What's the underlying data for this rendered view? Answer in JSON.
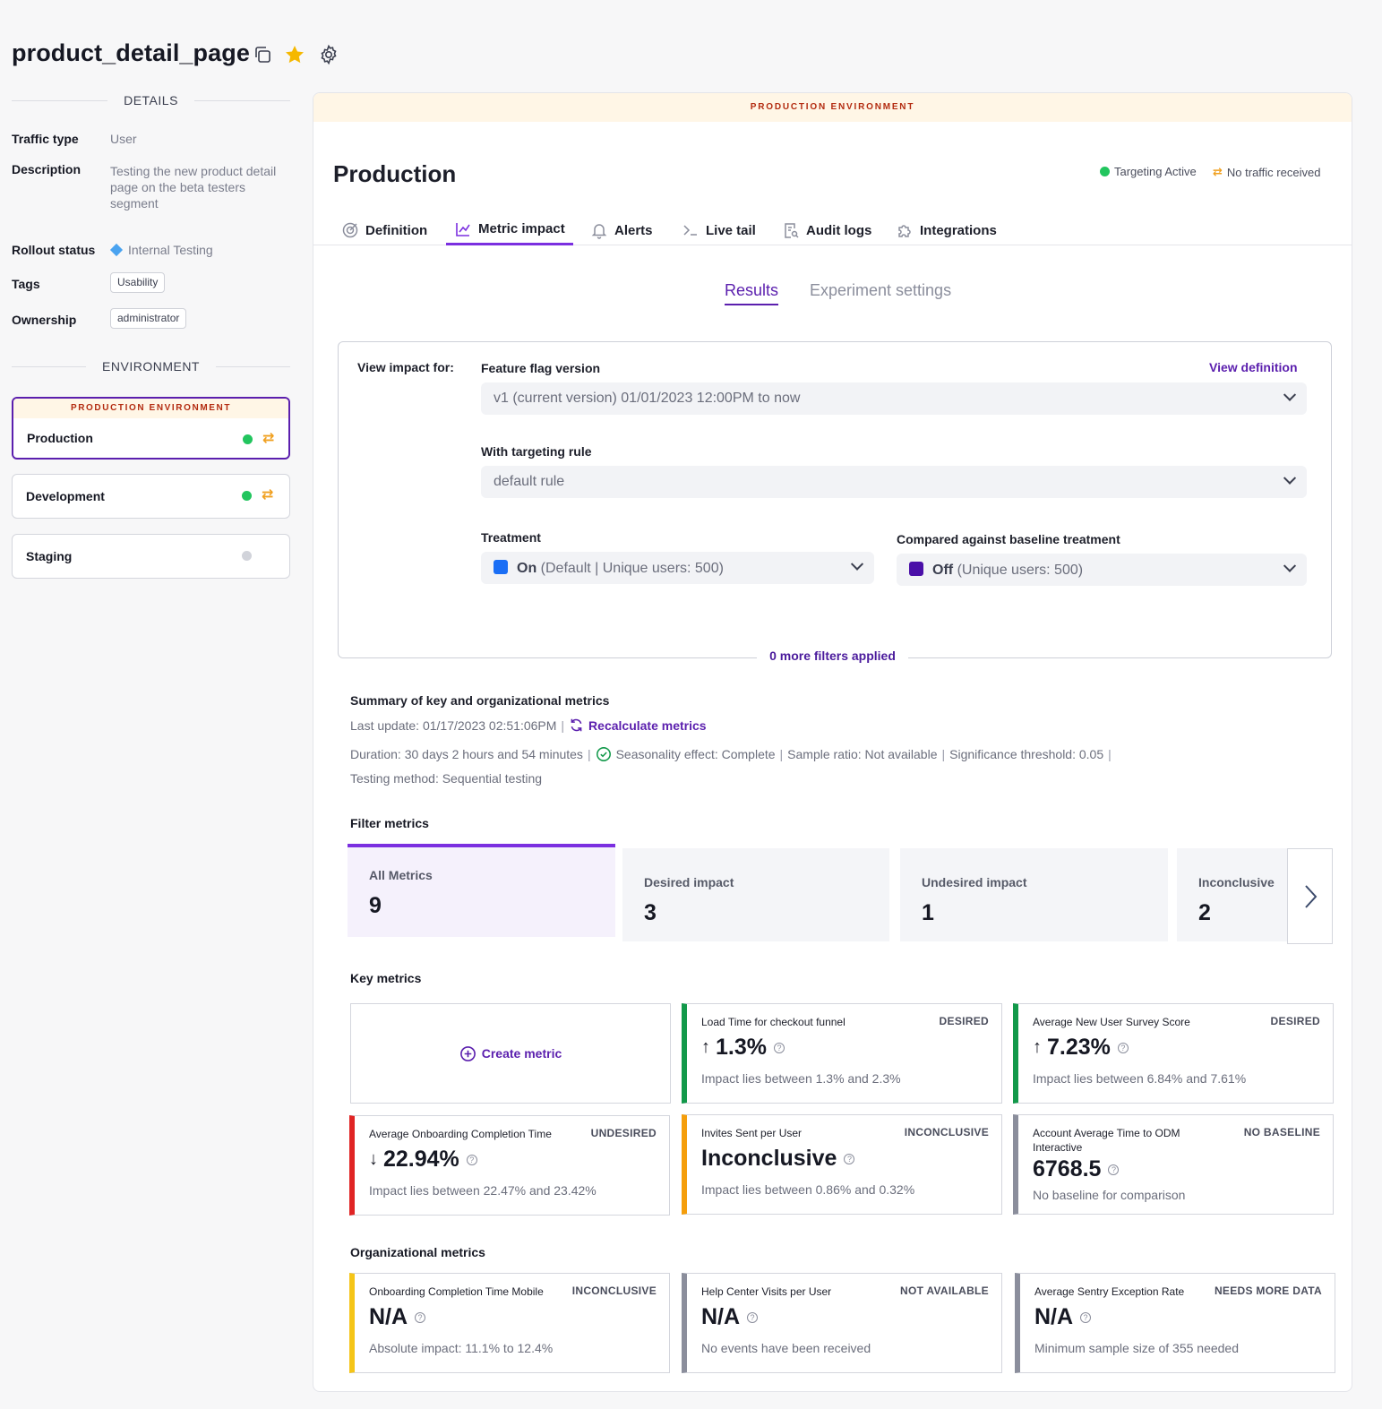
{
  "header": {
    "title": "product_detail_page"
  },
  "details": {
    "heading": "DETAILS",
    "traffic_type_label": "Traffic type",
    "traffic_type": "User",
    "description_label": "Description",
    "description": "Testing the new product detail page on the beta testers segment",
    "rollout_label": "Rollout status",
    "rollout": "Internal Testing",
    "tags_label": "Tags",
    "tag": "Usability",
    "ownership_label": "Ownership",
    "owner": "administrator"
  },
  "environment": {
    "heading": "ENVIRONMENT",
    "banner": "PRODUCTION ENVIRONMENT",
    "items": [
      {
        "name": "Production",
        "status_color": "#22c55e",
        "traffic": true
      },
      {
        "name": "Development",
        "status_color": "#22c55e",
        "traffic": true
      },
      {
        "name": "Staging",
        "status_color": "#d1d3da",
        "traffic": false
      }
    ]
  },
  "main": {
    "banner": "PRODUCTION ENVIRONMENT",
    "title": "Production",
    "targeting": "Targeting Active",
    "traffic": "No traffic received",
    "tabs": [
      "Definition",
      "Metric impact",
      "Alerts",
      "Live tail",
      "Audit logs",
      "Integrations"
    ],
    "subtabs": [
      "Results",
      "Experiment settings"
    ]
  },
  "filters": {
    "view_impact": "View impact for:",
    "version_label": "Feature flag version",
    "view_definition": "View definition",
    "version_value": "v1 (current version) 01/01/2023 12:00PM to now",
    "rule_label": "With targeting rule",
    "rule_value": "default rule",
    "treatment_label": "Treatment",
    "treatment_name": "On",
    "treatment_detail": "(Default | Unique users: 500)",
    "treatment_color": "#1a6ef5",
    "baseline_label": "Compared against baseline treatment",
    "baseline_name": "Off",
    "baseline_detail": "(Unique users: 500)",
    "baseline_color": "#4a0fa8",
    "more": "0 more filters applied"
  },
  "summary": {
    "title": "Summary of key and organizational metrics",
    "last_update": "Last update: 01/17/2023 02:51:06PM",
    "recalc": "Recalculate metrics",
    "duration": "Duration: 30 days 2 hours and 54 minutes",
    "seasonality": "Seasonality effect: Complete",
    "sample_ratio": "Sample ratio: Not available",
    "significance": "Significance threshold: 0.05",
    "method": "Testing method: Sequential testing"
  },
  "filter_metrics": {
    "title": "Filter metrics",
    "cards": [
      {
        "label": "All Metrics",
        "count": "9"
      },
      {
        "label": "Desired impact",
        "count": "3"
      },
      {
        "label": "Undesired impact",
        "count": "1"
      },
      {
        "label": "Inconclusive",
        "count": "2"
      }
    ]
  },
  "key_metrics": {
    "title": "Key metrics",
    "create": "Create metric",
    "cards": [
      {
        "name": "Load Time for checkout funnel",
        "status": "DESIRED",
        "arrow": "↑",
        "value": "1.3%",
        "sub": "Impact lies between 1.3% and 2.3%",
        "color": "#12994a"
      },
      {
        "name": "Average New User Survey Score",
        "status": "DESIRED",
        "arrow": "↑",
        "value": "7.23%",
        "sub": "Impact lies between 6.84% and 7.61%",
        "color": "#12994a"
      },
      {
        "name": "Average Onboarding Completion Time",
        "status": "UNDESIRED",
        "arrow": "↓",
        "value": "22.94%",
        "sub": "Impact lies between 22.47% and 23.42%",
        "color": "#e02424"
      },
      {
        "name": "Invites Sent per User",
        "status": "INCONCLUSIVE",
        "arrow": "",
        "value": "Inconclusive",
        "sub": "Impact lies between 0.86% and 0.32%",
        "color": "#f59e0b"
      },
      {
        "name": "Account Average Time to ODM Interactive",
        "status": "NO BASELINE",
        "arrow": "",
        "value": "6768.5",
        "sub": "No baseline for comparison",
        "color": "#8b8e9c"
      }
    ]
  },
  "org_metrics": {
    "title": "Organizational metrics",
    "cards": [
      {
        "name": "Onboarding Completion Time Mobile",
        "status": "INCONCLUSIVE",
        "value": "N/A",
        "sub": "Absolute impact: 11.1% to 12.4%",
        "color": "#f5c518"
      },
      {
        "name": "Help Center Visits per User",
        "status": "NOT AVAILABLE",
        "value": "N/A",
        "sub": "No events have been received",
        "color": "#8b8e9c"
      },
      {
        "name": "Average Sentry Exception Rate",
        "status": "NEEDS MORE DATA",
        "value": "N/A",
        "sub": "Minimum sample size of 355 needed",
        "color": "#8b8e9c"
      }
    ]
  }
}
